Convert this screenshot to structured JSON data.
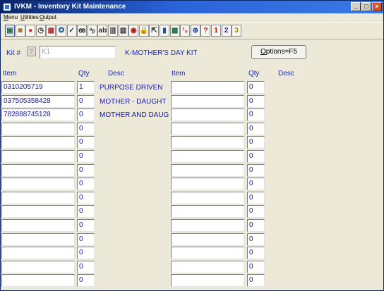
{
  "window": {
    "title": "IVKM - Inventory Kit Maintenance",
    "minimize_label": "_",
    "maximize_label": "□",
    "close_label": "×"
  },
  "menu": [
    {
      "name": "menu-menu",
      "label": "Menu"
    },
    {
      "name": "menu-utilities",
      "label": "Utilities"
    },
    {
      "name": "menu-output",
      "label": "Output"
    }
  ],
  "toolbar": [
    {
      "name": "toolbar-screen-icon",
      "glyph": "▣",
      "color": "#2a6c3a"
    },
    {
      "name": "toolbar-clipboard-icon",
      "glyph": "◙",
      "color": "#8a6a10"
    },
    {
      "name": "toolbar-apple-icon",
      "glyph": "●",
      "color": "#c83020"
    },
    {
      "name": "toolbar-clock-icon",
      "glyph": "◷",
      "color": "#303030"
    },
    {
      "name": "toolbar-calendar-icon",
      "glyph": "▦",
      "color": "#b03030"
    },
    {
      "name": "toolbar-gear-icon",
      "glyph": "✪",
      "color": "#1e5a8a"
    },
    {
      "name": "toolbar-check-icon",
      "glyph": "✓",
      "color": "#2a2a8a"
    },
    {
      "name": "toolbar-binoculars-icon",
      "glyph": "ꙭ",
      "color": "#202020"
    },
    {
      "name": "toolbar-abc-icon",
      "glyph": "ᵃᵦ",
      "color": "#303030"
    },
    {
      "name": "toolbar-spell-icon",
      "glyph": "ab",
      "color": "#303030"
    },
    {
      "name": "toolbar-barcode-icon",
      "glyph": "|||",
      "color": "#000000"
    },
    {
      "name": "toolbar-columns-icon",
      "glyph": "▥",
      "color": "#303030"
    },
    {
      "name": "toolbar-record-icon",
      "glyph": "◉",
      "color": "#b01010"
    },
    {
      "name": "toolbar-lock-icon",
      "glyph": "🔒",
      "color": "#b08010"
    },
    {
      "name": "toolbar-export-icon",
      "glyph": "⇱",
      "color": "#303030"
    },
    {
      "name": "toolbar-chart-icon",
      "glyph": "▮",
      "color": "#2050a0"
    },
    {
      "name": "toolbar-image-icon",
      "glyph": "▩",
      "color": "#1a6a4a"
    },
    {
      "name": "toolbar-number-icon",
      "glyph": "¹₀",
      "color": "#a02020"
    },
    {
      "name": "toolbar-globe-icon",
      "glyph": "⊕",
      "color": "#1a3aa0"
    },
    {
      "name": "toolbar-help-icon",
      "glyph": "?",
      "color": "#c01010"
    },
    {
      "name": "toolbar-1-icon",
      "glyph": "1",
      "color": "#c01010"
    },
    {
      "name": "toolbar-2-icon",
      "glyph": "2",
      "color": "#1a2aa0"
    },
    {
      "name": "toolbar-3-icon",
      "glyph": "3",
      "color": "#a08a00"
    }
  ],
  "kit": {
    "label": "Kit #",
    "help": "?",
    "value": "K1",
    "description": "K-MOTHER'S DAY KIT",
    "options_prefix": "O",
    "options_rest": "ptions=F5"
  },
  "columns": {
    "item": "Item",
    "qty": "Qty",
    "desc": "Desc"
  },
  "left_rows": [
    {
      "item": "0310205719",
      "qty": "1",
      "desc": "PURPOSE DRIVEN"
    },
    {
      "item": "037505358428",
      "qty": "0",
      "desc": "MOTHER - DAUGHT"
    },
    {
      "item": "782888745128",
      "qty": "0",
      "desc": "MOTHER AND DAUG"
    },
    {
      "item": "",
      "qty": "0",
      "desc": ""
    },
    {
      "item": "",
      "qty": "0",
      "desc": ""
    },
    {
      "item": "",
      "qty": "0",
      "desc": ""
    },
    {
      "item": "",
      "qty": "0",
      "desc": ""
    },
    {
      "item": "",
      "qty": "0",
      "desc": ""
    },
    {
      "item": "",
      "qty": "0",
      "desc": ""
    },
    {
      "item": "",
      "qty": "0",
      "desc": ""
    },
    {
      "item": "",
      "qty": "0",
      "desc": ""
    },
    {
      "item": "",
      "qty": "0",
      "desc": ""
    },
    {
      "item": "",
      "qty": "0",
      "desc": ""
    },
    {
      "item": "",
      "qty": "0",
      "desc": ""
    },
    {
      "item": "",
      "qty": "0",
      "desc": ""
    }
  ],
  "right_rows": [
    {
      "item": "",
      "qty": "0",
      "desc": ""
    },
    {
      "item": "",
      "qty": "0",
      "desc": ""
    },
    {
      "item": "",
      "qty": "0",
      "desc": ""
    },
    {
      "item": "",
      "qty": "0",
      "desc": ""
    },
    {
      "item": "",
      "qty": "0",
      "desc": ""
    },
    {
      "item": "",
      "qty": "0",
      "desc": ""
    },
    {
      "item": "",
      "qty": "0",
      "desc": ""
    },
    {
      "item": "",
      "qty": "0",
      "desc": ""
    },
    {
      "item": "",
      "qty": "0",
      "desc": ""
    },
    {
      "item": "",
      "qty": "0",
      "desc": ""
    },
    {
      "item": "",
      "qty": "0",
      "desc": ""
    },
    {
      "item": "",
      "qty": "0",
      "desc": ""
    },
    {
      "item": "",
      "qty": "0",
      "desc": ""
    },
    {
      "item": "",
      "qty": "0",
      "desc": ""
    },
    {
      "item": "",
      "qty": "0",
      "desc": ""
    }
  ]
}
